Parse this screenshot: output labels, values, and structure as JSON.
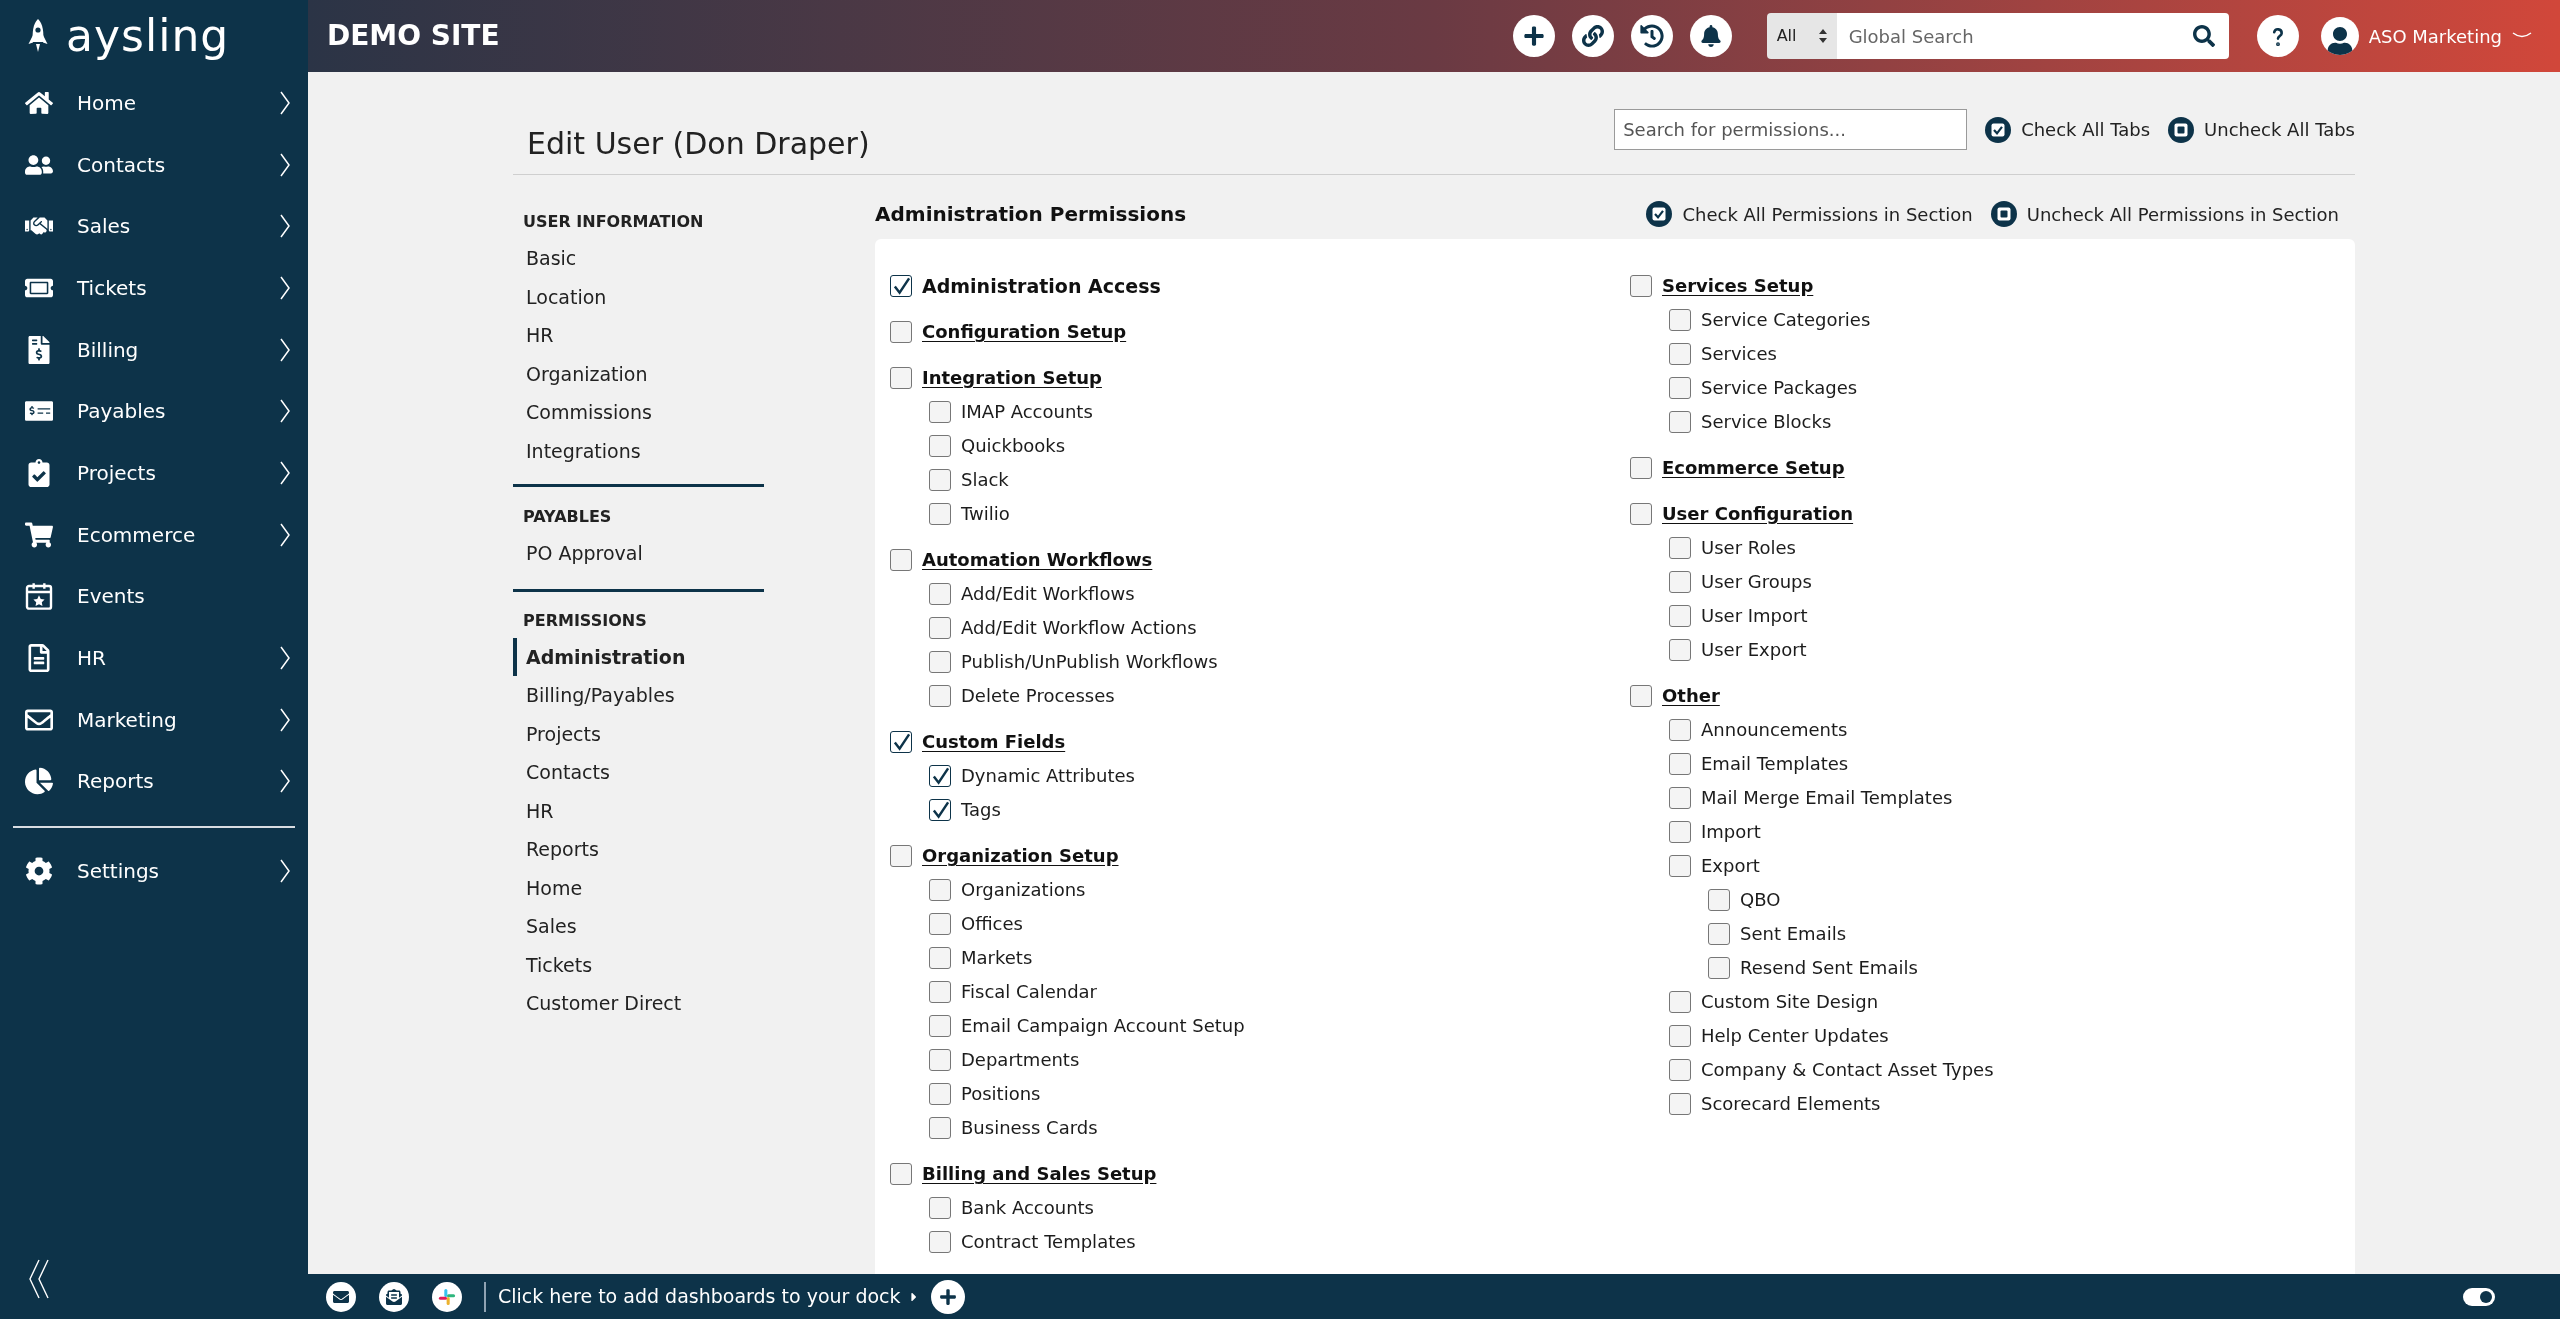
{
  "header": {
    "logo": "aysling",
    "site_name": "DEMO SITE",
    "search_scope": "All",
    "search": {
      "placeholder": "Global Search"
    },
    "user_name": "ASO Marketing"
  },
  "sidebar": {
    "items": [
      {
        "label": "Home",
        "has_submenu": true
      },
      {
        "label": "Contacts",
        "has_submenu": true
      },
      {
        "label": "Sales",
        "has_submenu": true
      },
      {
        "label": "Tickets",
        "has_submenu": true
      },
      {
        "label": "Billing",
        "has_submenu": true
      },
      {
        "label": "Payables",
        "has_submenu": true
      },
      {
        "label": "Projects",
        "has_submenu": true
      },
      {
        "label": "Ecommerce",
        "has_submenu": true
      },
      {
        "label": "Events",
        "has_submenu": false
      },
      {
        "label": "HR",
        "has_submenu": true
      },
      {
        "label": "Marketing",
        "has_submenu": true
      },
      {
        "label": "Reports",
        "has_submenu": true
      }
    ],
    "bottom_items": [
      {
        "label": "Settings",
        "has_submenu": true
      }
    ]
  },
  "page": {
    "title": "Edit User (Don Draper)",
    "search": {
      "placeholder": "Search for permissions..."
    },
    "actions": [
      {
        "label": "Check All Tabs",
        "kind": "check"
      },
      {
        "label": "Uncheck All Tabs",
        "kind": "uncheck"
      }
    ]
  },
  "nav": {
    "sections": [
      {
        "heading": "USER INFORMATION",
        "items": [
          {
            "label": "Basic",
            "selected": false
          },
          {
            "label": "Location",
            "selected": false
          },
          {
            "label": "HR",
            "selected": false
          },
          {
            "label": "Organization",
            "selected": false
          },
          {
            "label": "Commissions",
            "selected": false
          },
          {
            "label": "Integrations",
            "selected": false
          }
        ]
      },
      {
        "heading": "PAYABLES",
        "items": [
          {
            "label": "PO Approval",
            "selected": false
          }
        ]
      },
      {
        "heading": "PERMISSIONS",
        "items": [
          {
            "label": "Administration",
            "selected": true
          },
          {
            "label": "Billing/Payables",
            "selected": false
          },
          {
            "label": "Projects",
            "selected": false
          },
          {
            "label": "Contacts",
            "selected": false
          },
          {
            "label": "HR",
            "selected": false
          },
          {
            "label": "Reports",
            "selected": false
          },
          {
            "label": "Home",
            "selected": false
          },
          {
            "label": "Sales",
            "selected": false
          },
          {
            "label": "Tickets",
            "selected": false
          },
          {
            "label": "Customer Direct",
            "selected": false
          }
        ]
      }
    ]
  },
  "panel": {
    "title": "Administration Permissions",
    "actions": [
      {
        "label": "Check All Permissions in Section",
        "kind": "check"
      },
      {
        "label": "Uncheck All Permissions in Section",
        "kind": "uncheck"
      }
    ],
    "columns": [
      {
        "groups": [
          {
            "label": "Administration Access",
            "kind": "access",
            "checked": true
          },
          {
            "label": "Configuration Setup",
            "kind": "section",
            "checked": false
          },
          {
            "label": "Integration Setup",
            "kind": "section",
            "checked": false,
            "children": [
              {
                "label": "IMAP Accounts",
                "checked": false
              },
              {
                "label": "Quickbooks",
                "checked": false
              },
              {
                "label": "Slack",
                "checked": false
              },
              {
                "label": "Twilio",
                "checked": false
              }
            ]
          },
          {
            "label": "Automation Workflows",
            "kind": "section",
            "checked": false,
            "children": [
              {
                "label": "Add/Edit Workflows",
                "checked": false
              },
              {
                "label": "Add/Edit Workflow Actions",
                "checked": false
              },
              {
                "label": "Publish/UnPublish Workflows",
                "checked": false
              },
              {
                "label": "Delete Processes",
                "checked": false
              }
            ]
          },
          {
            "label": "Custom Fields",
            "kind": "section",
            "checked": true,
            "children": [
              {
                "label": "Dynamic Attributes",
                "checked": true
              },
              {
                "label": "Tags",
                "checked": true
              }
            ]
          },
          {
            "label": "Organization Setup",
            "kind": "section",
            "checked": false,
            "children": [
              {
                "label": "Organizations",
                "checked": false
              },
              {
                "label": "Offices",
                "checked": false
              },
              {
                "label": "Markets",
                "checked": false
              },
              {
                "label": "Fiscal Calendar",
                "checked": false
              },
              {
                "label": "Email Campaign Account Setup",
                "checked": false
              },
              {
                "label": "Departments",
                "checked": false
              },
              {
                "label": "Positions",
                "checked": false
              },
              {
                "label": "Business Cards",
                "checked": false
              }
            ]
          },
          {
            "label": "Billing and Sales Setup",
            "kind": "section",
            "checked": false,
            "children": [
              {
                "label": "Bank Accounts",
                "checked": false
              },
              {
                "label": "Contract Templates",
                "checked": false
              }
            ]
          }
        ]
      },
      {
        "groups": [
          {
            "label": "Services Setup",
            "kind": "section",
            "checked": false,
            "children": [
              {
                "label": "Service Categories",
                "checked": false
              },
              {
                "label": "Services",
                "checked": false
              },
              {
                "label": "Service Packages",
                "checked": false
              },
              {
                "label": "Service Blocks",
                "checked": false
              }
            ]
          },
          {
            "label": "Ecommerce Setup",
            "kind": "section",
            "checked": false
          },
          {
            "label": "User Configuration",
            "kind": "section",
            "checked": false,
            "children": [
              {
                "label": "User Roles",
                "checked": false
              },
              {
                "label": "User Groups",
                "checked": false
              },
              {
                "label": "User Import",
                "checked": false
              },
              {
                "label": "User Export",
                "checked": false
              }
            ]
          },
          {
            "label": "Other",
            "kind": "section",
            "checked": false,
            "children": [
              {
                "label": "Announcements",
                "checked": false
              },
              {
                "label": "Email Templates",
                "checked": false
              },
              {
                "label": "Mail Merge Email Templates",
                "checked": false
              },
              {
                "label": "Import",
                "checked": false
              },
              {
                "label": "Export",
                "checked": false,
                "children": [
                  {
                    "label": "QBO",
                    "checked": false
                  },
                  {
                    "label": "Sent Emails",
                    "checked": false
                  },
                  {
                    "label": "Resend Sent Emails",
                    "checked": false
                  }
                ]
              },
              {
                "label": "Custom Site Design",
                "checked": false
              },
              {
                "label": "Help Center Updates",
                "checked": false
              },
              {
                "label": "Company & Contact Asset Types",
                "checked": false
              },
              {
                "label": "Scorecard Elements",
                "checked": false
              }
            ]
          }
        ]
      }
    ]
  },
  "dock": {
    "hint": "Click here to add dashboards to your dock",
    "toggle_on": true
  }
}
